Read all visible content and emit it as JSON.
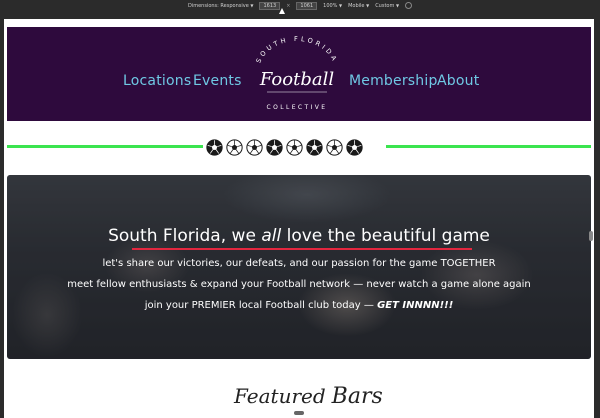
{
  "devtools": {
    "dimensions_label": "Dimensions: Responsive",
    "width": "1613",
    "height": "1061",
    "zoom": "100%",
    "device": "Mobile",
    "throttle": "Custom"
  },
  "header": {
    "nav_left": [
      "Locations",
      "Events"
    ],
    "nav_right": [
      "Membership",
      "About"
    ],
    "logo": {
      "top_text": "SOUTH FLORIDA",
      "main_text": "Football",
      "bottom_text": "COLLECTIVE"
    }
  },
  "divider": {
    "color": "#3be44f",
    "ball_styles": [
      "filled",
      "outline",
      "outline",
      "filled",
      "outline",
      "filled",
      "outline",
      "filled"
    ]
  },
  "hero": {
    "title_before": "South Florida, we ",
    "title_em": "all",
    "title_after": " love the beautiful game",
    "line1_before": "let's share our victories, our defeats, and our passion for the game ",
    "line1_caps": "TOGETHER",
    "line2": "meet fellow enthusiasts & expand your Football network — never watch a game alone again",
    "line3_before": "join your ",
    "line3_caps": "PREMIER",
    "line3_mid": " local Football club today — ",
    "line3_bold": "GET INNNN!!!",
    "accent": "#e3263f"
  },
  "section": {
    "heading_part1": "Featured",
    "heading_part2": "Bars"
  },
  "colors": {
    "header_bg": "#2e0a3d",
    "nav_link": "#6fc8e4"
  }
}
